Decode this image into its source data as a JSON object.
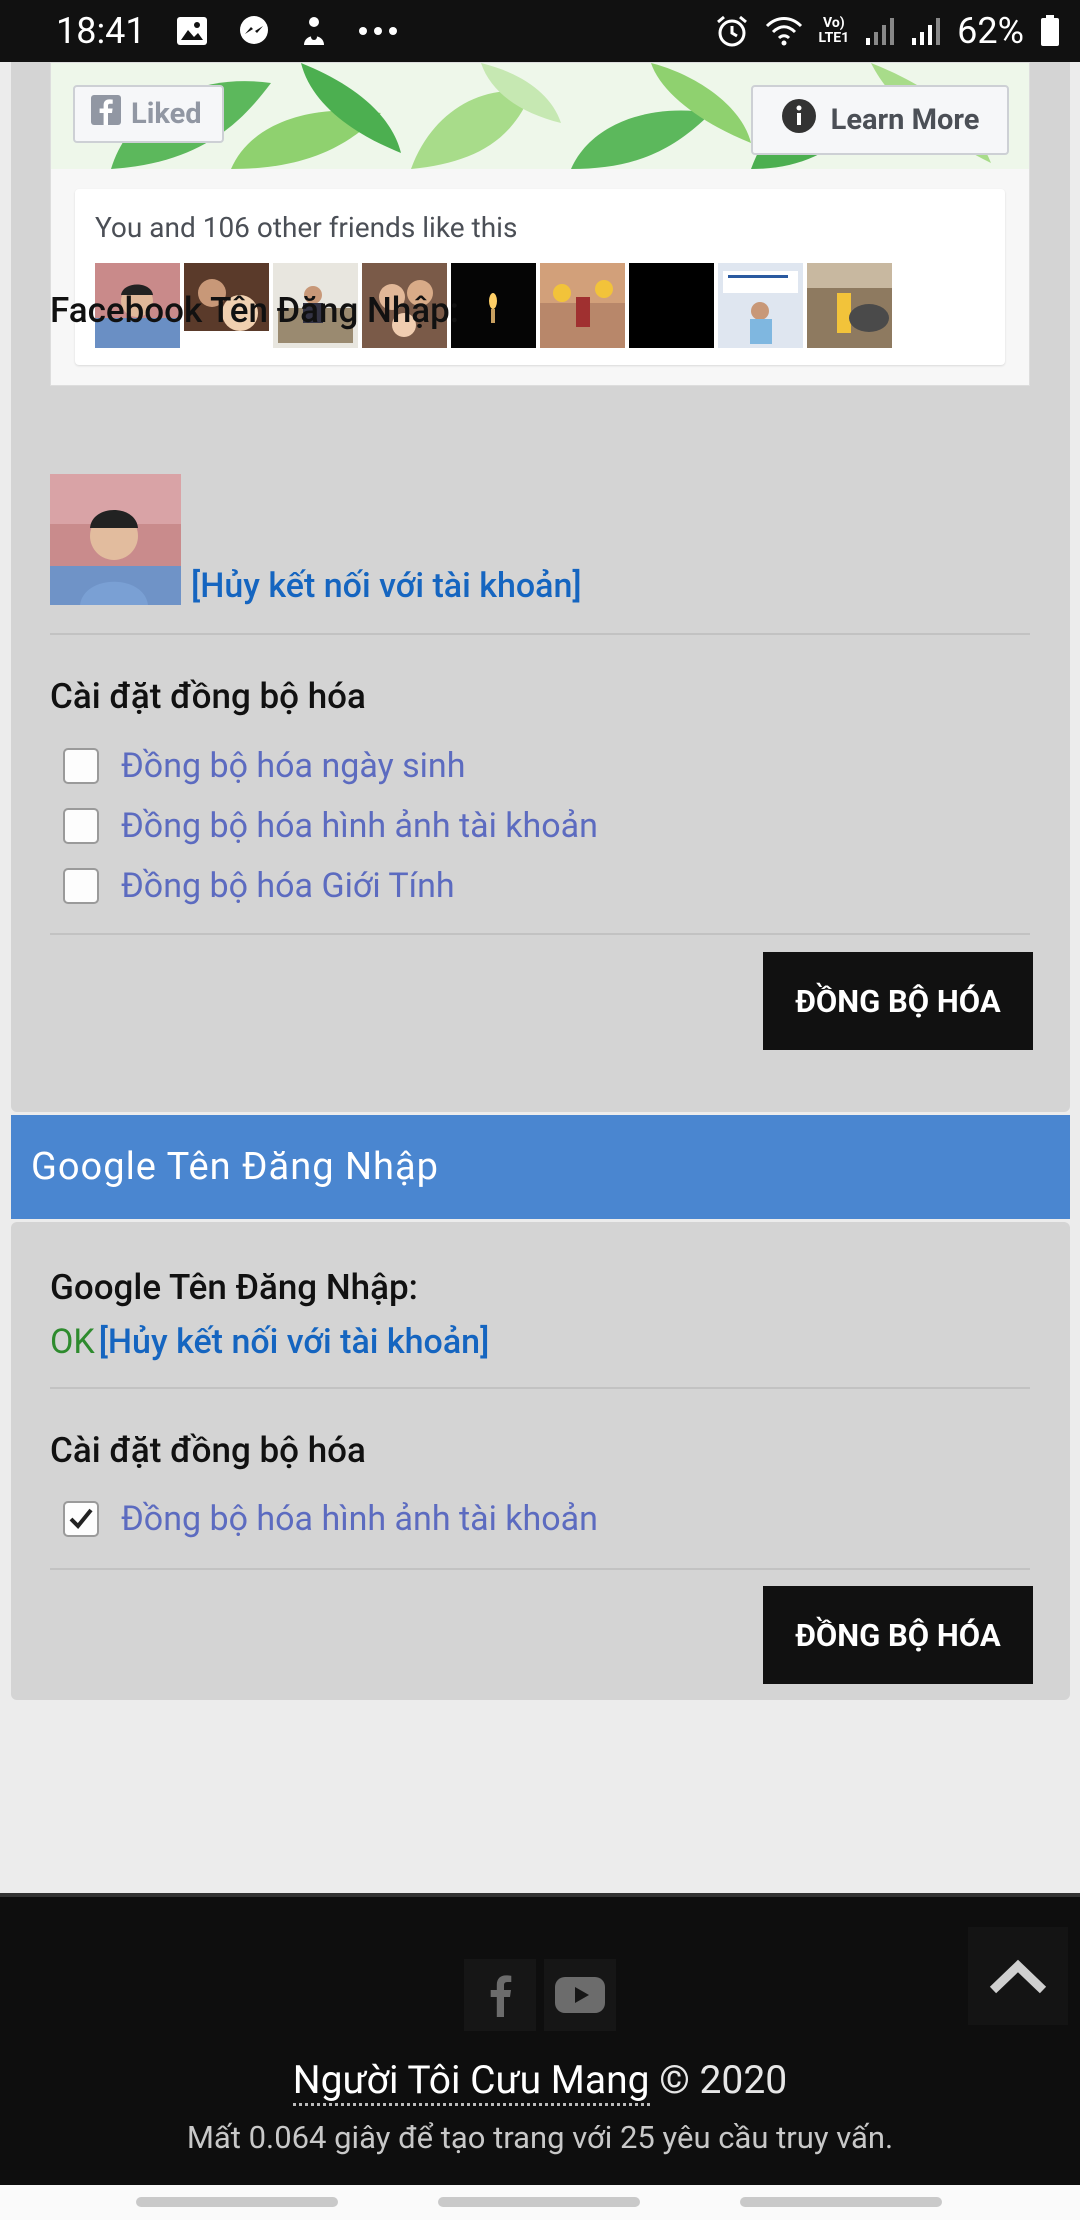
{
  "status_bar": {
    "time": "18:41",
    "battery": "62%",
    "left_icons": [
      "image-icon",
      "messenger-icon",
      "notification-icon",
      "more-dots-icon"
    ],
    "right_icons": [
      "alarm-icon",
      "wifi-icon",
      "volte-icon",
      "signal-icon",
      "signal-icon",
      "battery-icon"
    ],
    "volte_label": "Vo)\nLTE1"
  },
  "facebook_widget": {
    "liked_label": "Liked",
    "learn_more_label": "Learn More",
    "friends_text": "You and 106 other friends like this"
  },
  "facebook_login": {
    "title": "Facebook Tên Đăng Nhập:",
    "unlink_label": "[Hủy kết nối với tài khoản]",
    "sync_settings_title": "Cài đặt đồng bộ hóa",
    "options": [
      {
        "label": "Đồng bộ hóa ngày sinh",
        "checked": false
      },
      {
        "label": "Đồng bộ hóa hình ảnh tài khoản",
        "checked": false
      },
      {
        "label": "Đồng bộ hóa Giới Tính",
        "checked": false
      }
    ],
    "sync_button": "ĐỒNG BỘ HÓA"
  },
  "google_login": {
    "header": "Google Tên Đăng Nhập",
    "title": "Google Tên Đăng Nhập:",
    "status": "OK",
    "unlink_label": "[Hủy kết nối với tài khoản]",
    "sync_settings_title": "Cài đặt đồng bộ hóa",
    "options": [
      {
        "label": "Đồng bộ hóa hình ảnh tài khoản",
        "checked": true
      }
    ],
    "sync_button": "ĐỒNG BỘ HÓA"
  },
  "footer": {
    "site_name": "Người Tôi Cưu Mang",
    "copyright": "© 2020",
    "stats": "Mất 0.064 giây để tạo trang với 25 yêu cầu truy vấn."
  },
  "colors": {
    "link": "#1565c0",
    "checkbox_label": "#5c6bc0",
    "google_header": "#4a86d0",
    "ok_status": "#2e8b2e"
  }
}
